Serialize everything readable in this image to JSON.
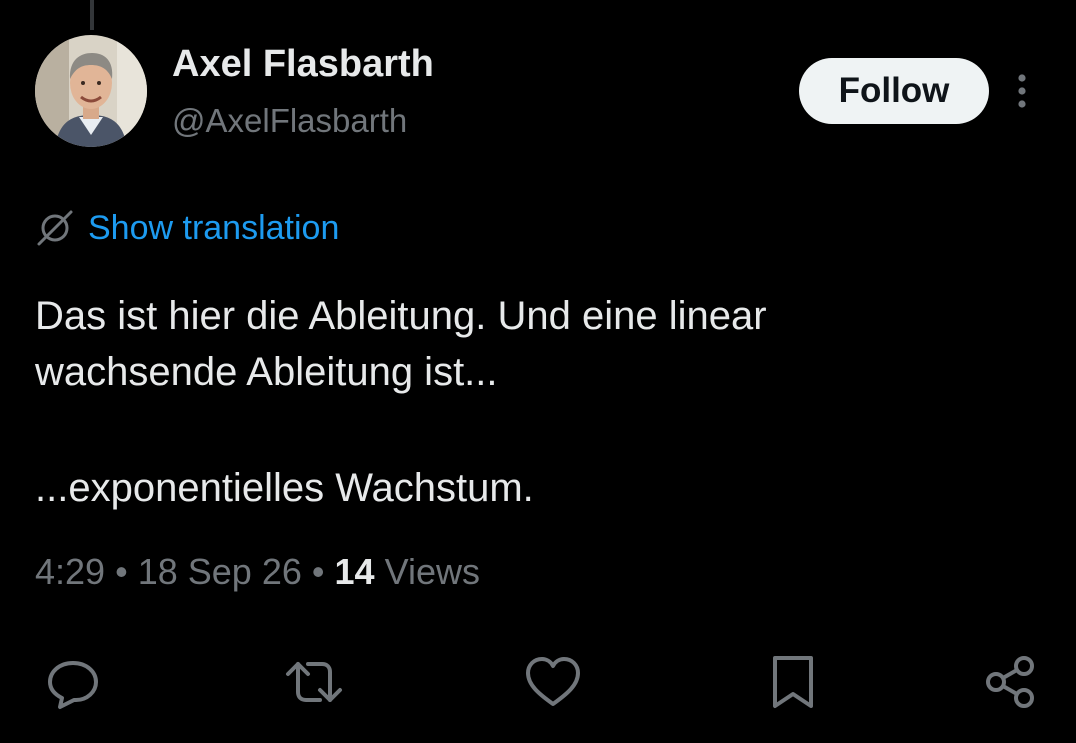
{
  "author": {
    "name": "Axel Flasbarth",
    "handle": "@AxelFlasbarth"
  },
  "follow_label": "Follow",
  "translation_label": "Show translation",
  "tweet": {
    "lines": [
      "Das ist hier die Ableitung. Und eine linear",
      "wachsende Ableitung ist...",
      "...exponentielles Wachstum."
    ]
  },
  "meta": {
    "time": "4:29",
    "separator": "•",
    "date": "18 Sep 26",
    "views_count": "14",
    "views_label": "Views"
  },
  "colors": {
    "background": "#000000",
    "text_primary": "#e7e9ea",
    "text_secondary": "#71767b",
    "link": "#1d9bf0",
    "follow_button_bg": "#eff3f4"
  },
  "icons": {
    "more": "more-vertical-icon",
    "translation": "globe-slash-icon",
    "reply": "reply-icon",
    "retweet": "retweet-icon",
    "like": "heart-icon",
    "bookmark": "bookmark-icon",
    "share": "share-icon"
  }
}
